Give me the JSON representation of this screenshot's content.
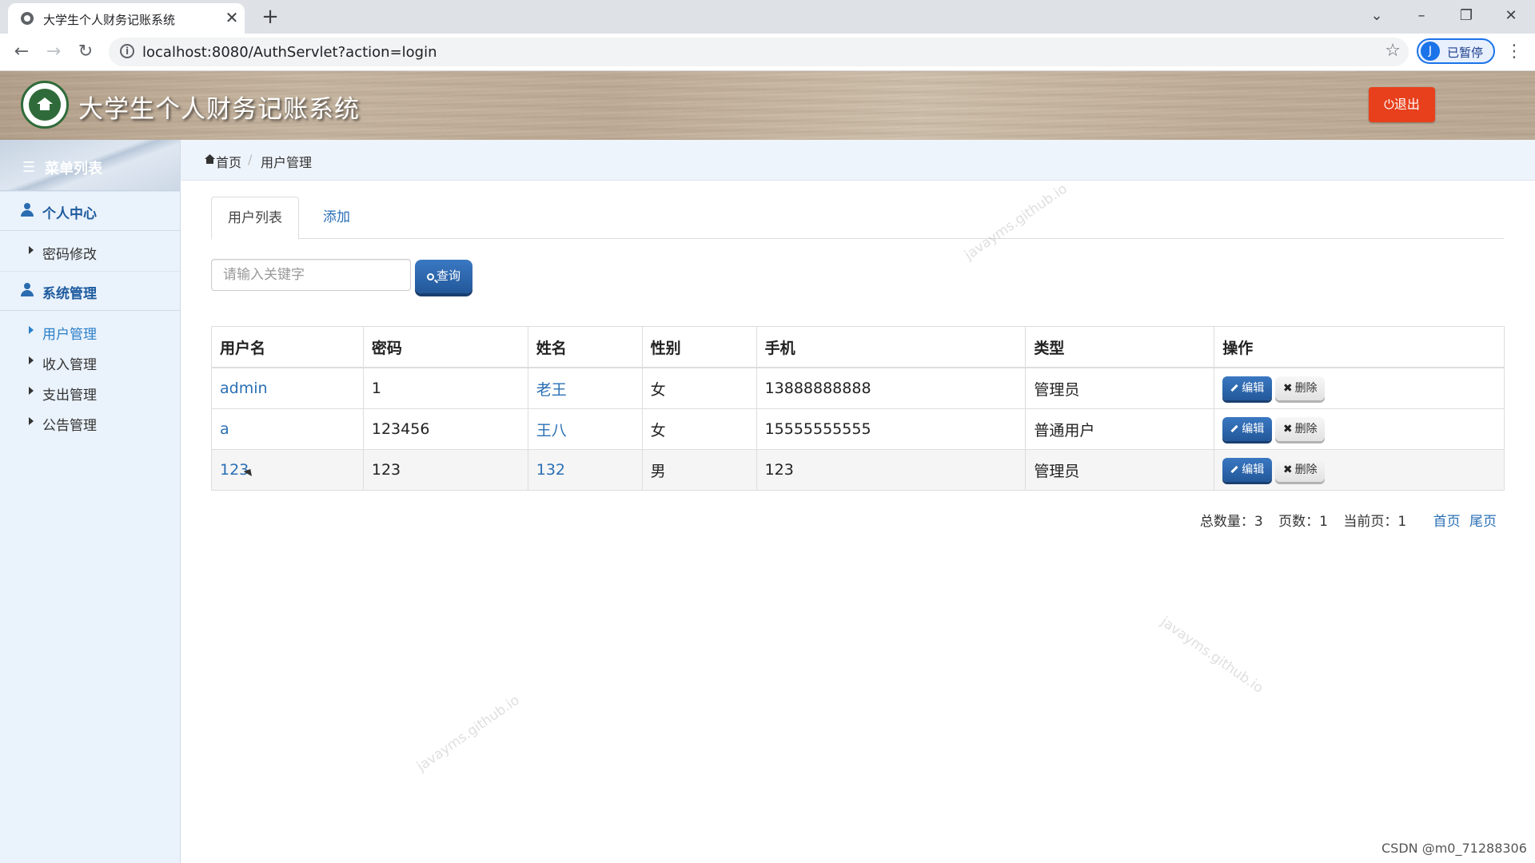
{
  "browser": {
    "tab_title": "大学生个人财务记账系统",
    "url": "localhost:8080/AuthServlet?action=login",
    "profile_initial": "J",
    "profile_label": "已暂停"
  },
  "header": {
    "title": "大学生个人财务记账系统",
    "logout_label": "退出"
  },
  "sidebar": {
    "title": "菜单列表",
    "groups": [
      {
        "label": "个人中心",
        "items": [
          {
            "label": "密码修改"
          }
        ]
      },
      {
        "label": "系统管理",
        "items": [
          {
            "label": "用户管理",
            "active": true
          },
          {
            "label": "收入管理"
          },
          {
            "label": "支出管理"
          },
          {
            "label": "公告管理"
          }
        ]
      }
    ]
  },
  "breadcrumb": {
    "home": "首页",
    "current": "用户管理"
  },
  "tabs": [
    {
      "label": "用户列表",
      "active": true
    },
    {
      "label": "添加"
    }
  ],
  "search": {
    "placeholder": "请输入关键字",
    "button_label": "查询"
  },
  "table": {
    "headers": [
      "用户名",
      "密码",
      "姓名",
      "性别",
      "手机",
      "类型",
      "操作"
    ],
    "rows": [
      {
        "username": "admin",
        "password": "1",
        "name": "老王",
        "gender": "女",
        "phone": "13888888888",
        "type": "管理员"
      },
      {
        "username": "a",
        "password": "123456",
        "name": "王八",
        "gender": "女",
        "phone": "15555555555",
        "type": "普通用户"
      },
      {
        "username": "123",
        "password": "123",
        "name": "132",
        "gender": "男",
        "phone": "123",
        "type": "管理员"
      }
    ],
    "edit_label": "编辑",
    "delete_label": "删除"
  },
  "pager": {
    "total": "总数量：3",
    "pages": "页数：1",
    "current": "当前页：1",
    "first": "首页",
    "last": "尾页"
  },
  "watermark": "javayms.github.io",
  "footer_credit": "CSDN @m0_71288306",
  "colors": {
    "logout": "#e8401c",
    "primary": "#2b64a8",
    "link": "#2a6fb5",
    "sidebar_bg": "#eaf2fb"
  }
}
